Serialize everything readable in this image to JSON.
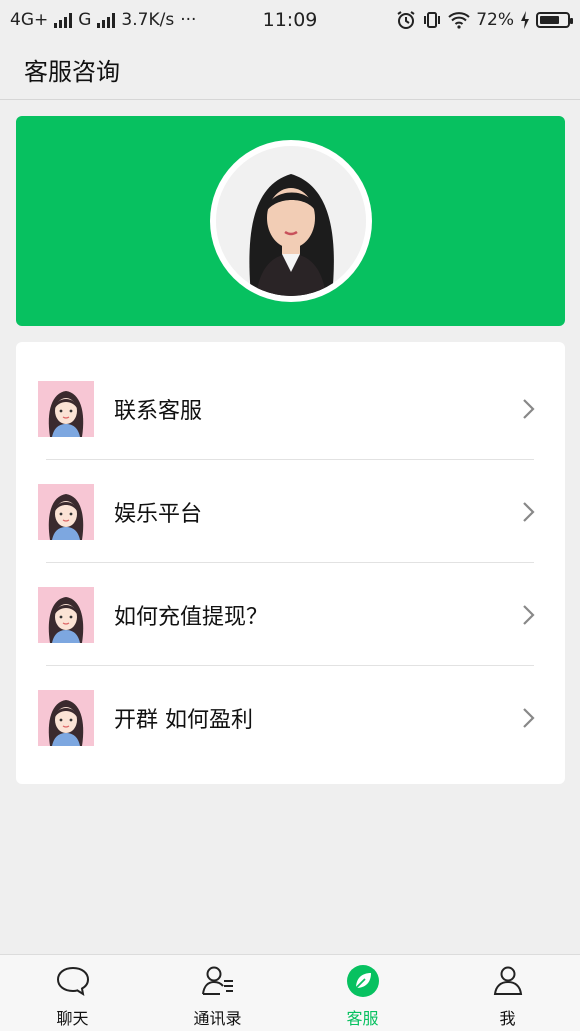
{
  "status_bar": {
    "network_1": "4G+",
    "network_2": "G",
    "speed": "3.7K/s",
    "more": "···",
    "time": "11:09",
    "battery_percent": "72%",
    "battery_level": 0.72
  },
  "header": {
    "title": "客服咨询"
  },
  "banner": {
    "accent_color": "#07c160",
    "avatar_icon": "profile-photo"
  },
  "menu": {
    "items": [
      {
        "label": "联系客服",
        "icon": "cartoon-avatar",
        "chevron": "chevron-right-icon"
      },
      {
        "label": "娱乐平台",
        "icon": "cartoon-avatar",
        "chevron": "chevron-right-icon"
      },
      {
        "label": "如何充值提现？",
        "icon": "cartoon-avatar",
        "chevron": "chevron-right-icon"
      },
      {
        "label": "开群 如何盈利",
        "icon": "cartoon-avatar",
        "chevron": "chevron-right-icon"
      }
    ]
  },
  "tabbar": {
    "active_color": "#07c160",
    "tabs": [
      {
        "label": "聊天",
        "icon": "chat-bubble-icon",
        "active": false
      },
      {
        "label": "通讯录",
        "icon": "contacts-icon",
        "active": false
      },
      {
        "label": "客服",
        "icon": "leaf-icon",
        "active": true
      },
      {
        "label": "我",
        "icon": "person-icon",
        "active": false
      }
    ]
  }
}
